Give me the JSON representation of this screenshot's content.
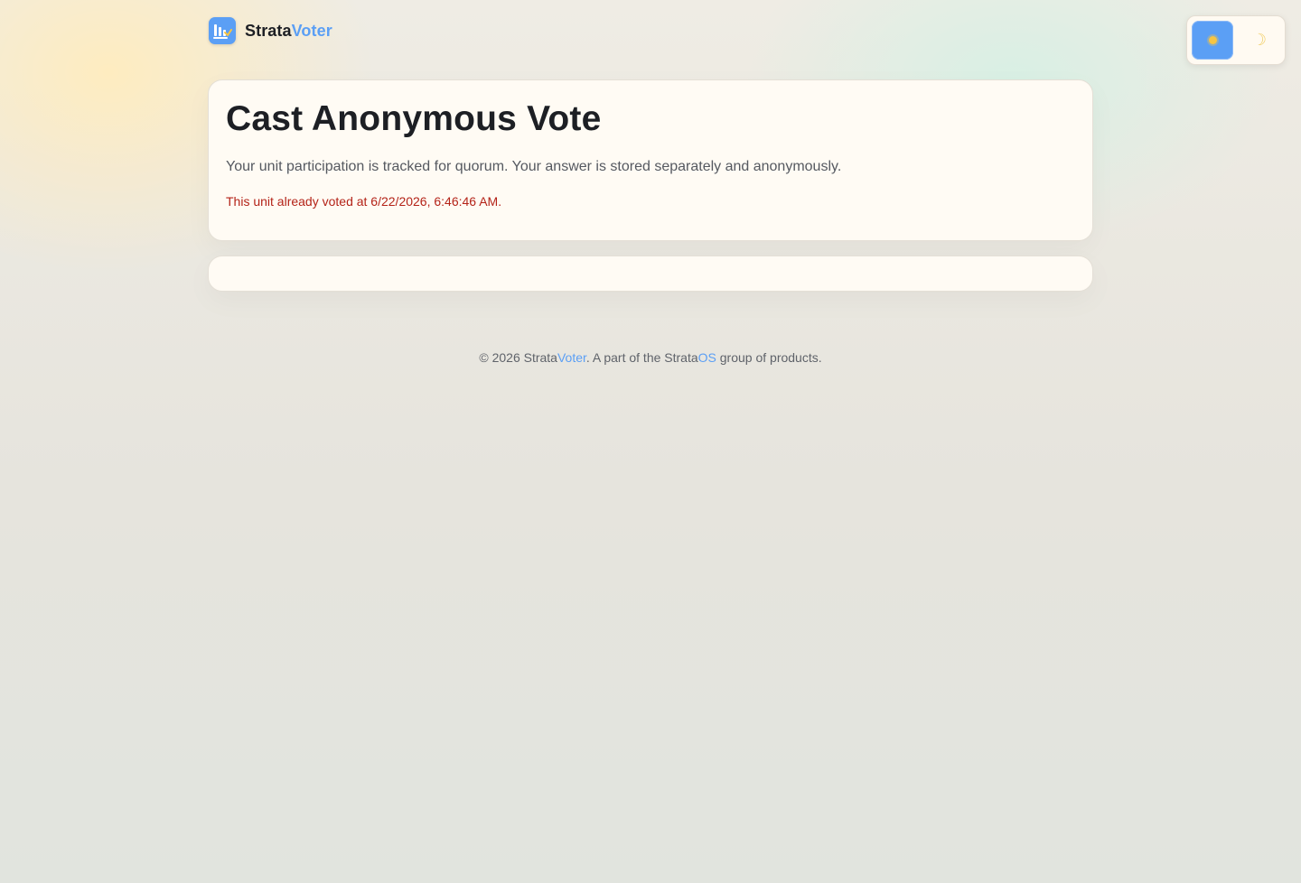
{
  "brand": {
    "name_part1": "Strata",
    "name_part2": "Voter",
    "logo_icon": "bar-chart-check-icon"
  },
  "theme_toggle": {
    "light_icon": "sun-icon",
    "dark_icon": "moon-icon",
    "active": "light"
  },
  "vote_card": {
    "title": "Cast Anonymous Vote",
    "description": "Your unit participation is tracked for quorum. Your answer is stored separately and anonymously.",
    "status_message": "This unit already voted at 6/22/2026, 6:46:46 AM."
  },
  "footer": {
    "prefix": "© 2026 Strata",
    "product": "Voter",
    "middle": ". A part of the Strata",
    "group": "OS",
    "suffix": " group of products."
  },
  "colors": {
    "accent": "#5b9ff5",
    "error": "#b42318",
    "card_bg": "#fffbf4",
    "text": "#1d1f24"
  }
}
